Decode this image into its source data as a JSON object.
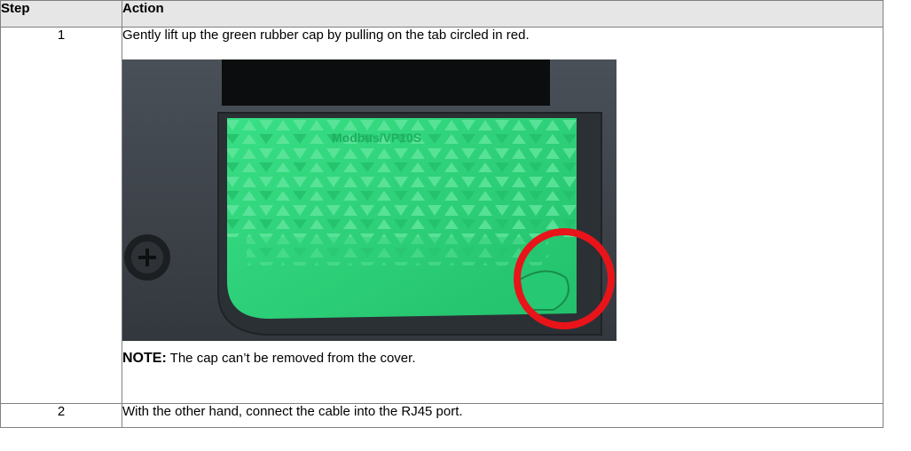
{
  "table": {
    "headers": {
      "step": "Step",
      "action": "Action"
    },
    "rows": [
      {
        "step": "1",
        "action": "Gently lift up the green rubber cap by pulling on the tab circled in red.",
        "image": {
          "cap_label": "Modbus/VP10S",
          "icon": "rubber-cap-photo"
        },
        "note_label": "NOTE:",
        "note_text": " The cap can’t be removed from the cover."
      },
      {
        "step": "2",
        "action": "With the other hand, connect the cable into the RJ45 port."
      }
    ]
  },
  "colors": {
    "header_bg": "#e6e6e6",
    "border": "#808080",
    "cap_green": "#2ed37a",
    "highlight_red": "#e8141a",
    "device_gray": "#3a4047"
  }
}
